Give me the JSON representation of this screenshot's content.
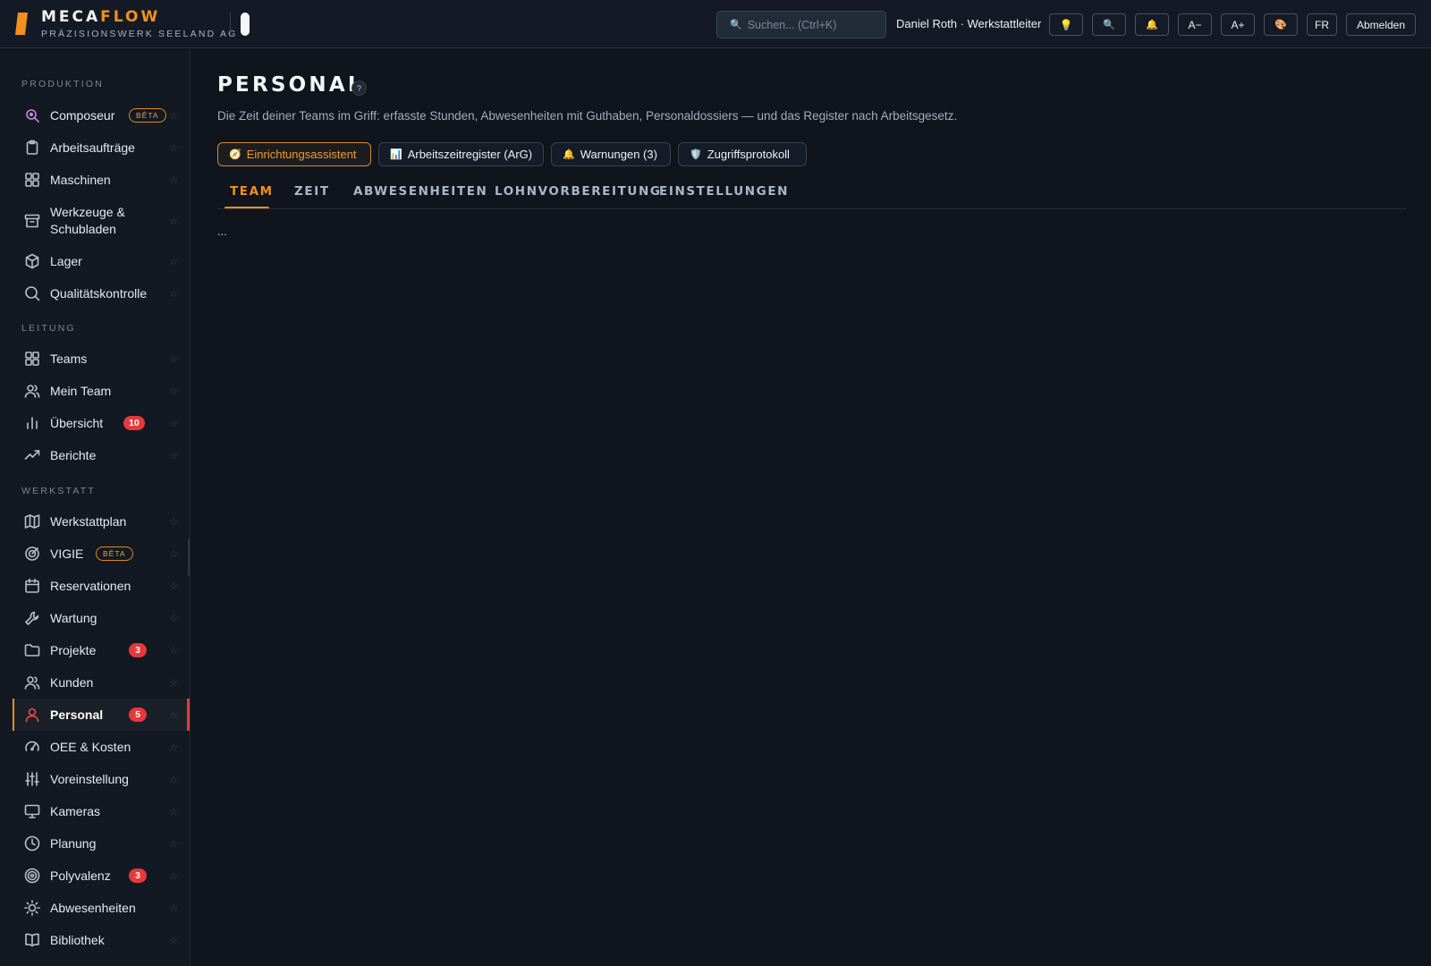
{
  "brand": {
    "name_a": "MECA",
    "name_b": "FLOW",
    "subtitle": "PRÄZISIONSWERK SEELAND AG"
  },
  "topbar": {
    "search_placeholder": "Suchen...  (Ctrl+K)",
    "user": "Daniel Roth · Werkstattleiter",
    "btn_font_smaller": "A−",
    "btn_font_larger": "A+",
    "btn_lang": "FR",
    "btn_logout": "Abmelden"
  },
  "sidebar": {
    "sections": [
      {
        "label": "PRODUKTION"
      },
      {
        "label": "LEITUNG"
      },
      {
        "label": "WERKSTATT"
      }
    ],
    "items": [
      {
        "label": "Composeur",
        "badge_beta": "BÊTA"
      },
      {
        "label": "Arbeitsaufträge"
      },
      {
        "label": "Maschinen"
      },
      {
        "label": "Werkzeuge &\nSchubladen"
      },
      {
        "label": "Lager"
      },
      {
        "label": "Qualitätskontrolle"
      },
      {
        "label": "Teams"
      },
      {
        "label": "Mein Team"
      },
      {
        "label": "Übersicht",
        "badge": "10"
      },
      {
        "label": "Berichte"
      },
      {
        "label": "Werkstattplan"
      },
      {
        "label": "VIGIE",
        "badge_beta": "BÊTA"
      },
      {
        "label": "Reservationen"
      },
      {
        "label": "Wartung"
      },
      {
        "label": "Projekte",
        "badge": "3"
      },
      {
        "label": "Kunden"
      },
      {
        "label": "Personal",
        "badge": "5"
      },
      {
        "label": "OEE & Kosten"
      },
      {
        "label": "Voreinstellung"
      },
      {
        "label": "Kameras"
      },
      {
        "label": "Planung"
      },
      {
        "label": "Polyvalenz",
        "badge": "3"
      },
      {
        "label": "Abwesenheiten"
      },
      {
        "label": "Bibliothek"
      }
    ]
  },
  "main": {
    "title": "PERSONAL",
    "help": "?",
    "subtitle": "Die Zeit deiner Teams im Griff: erfasste Stunden, Abwesenheiten mit Guthaben, Personaldossiers — und das Register nach Arbeitsgesetz.",
    "chips": [
      {
        "label": "Einrichtungsassistent"
      },
      {
        "label": "Arbeitszeitregister (ArG)"
      },
      {
        "label": "Warnungen (3)"
      },
      {
        "label": "Zugriffsprotokoll"
      }
    ],
    "tabs": [
      {
        "label": "TEAM"
      },
      {
        "label": "ZEIT"
      },
      {
        "label": "ABWESENHEITEN"
      },
      {
        "label": "LOHNVORBEREITUNG"
      },
      {
        "label": "EINSTELLUNGEN"
      }
    ],
    "content_placeholder": "..."
  }
}
